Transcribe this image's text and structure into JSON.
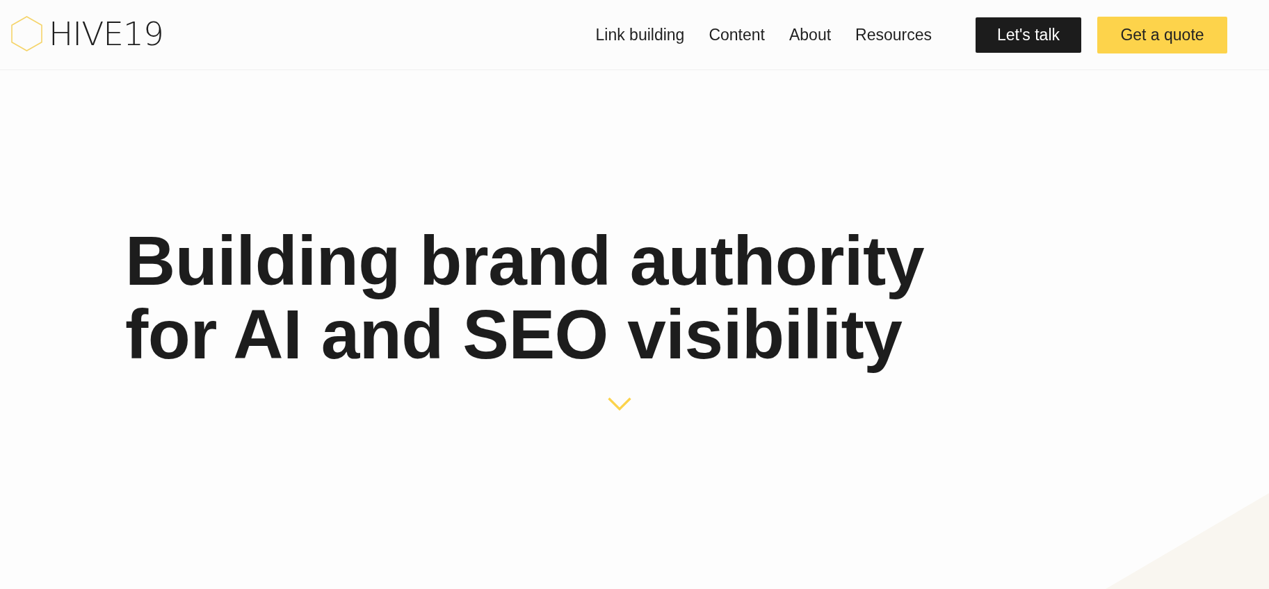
{
  "logo": {
    "text": "HIVE19"
  },
  "nav": {
    "links": [
      {
        "label": "Link building"
      },
      {
        "label": "Content"
      },
      {
        "label": "About"
      },
      {
        "label": "Resources"
      }
    ]
  },
  "buttons": [
    {
      "label": "Let's talk",
      "kind": "dark"
    },
    {
      "label": "Get a quote",
      "kind": "accent"
    }
  ],
  "hero": {
    "headline": "Building brand authority for AI and SEO visibility"
  }
}
